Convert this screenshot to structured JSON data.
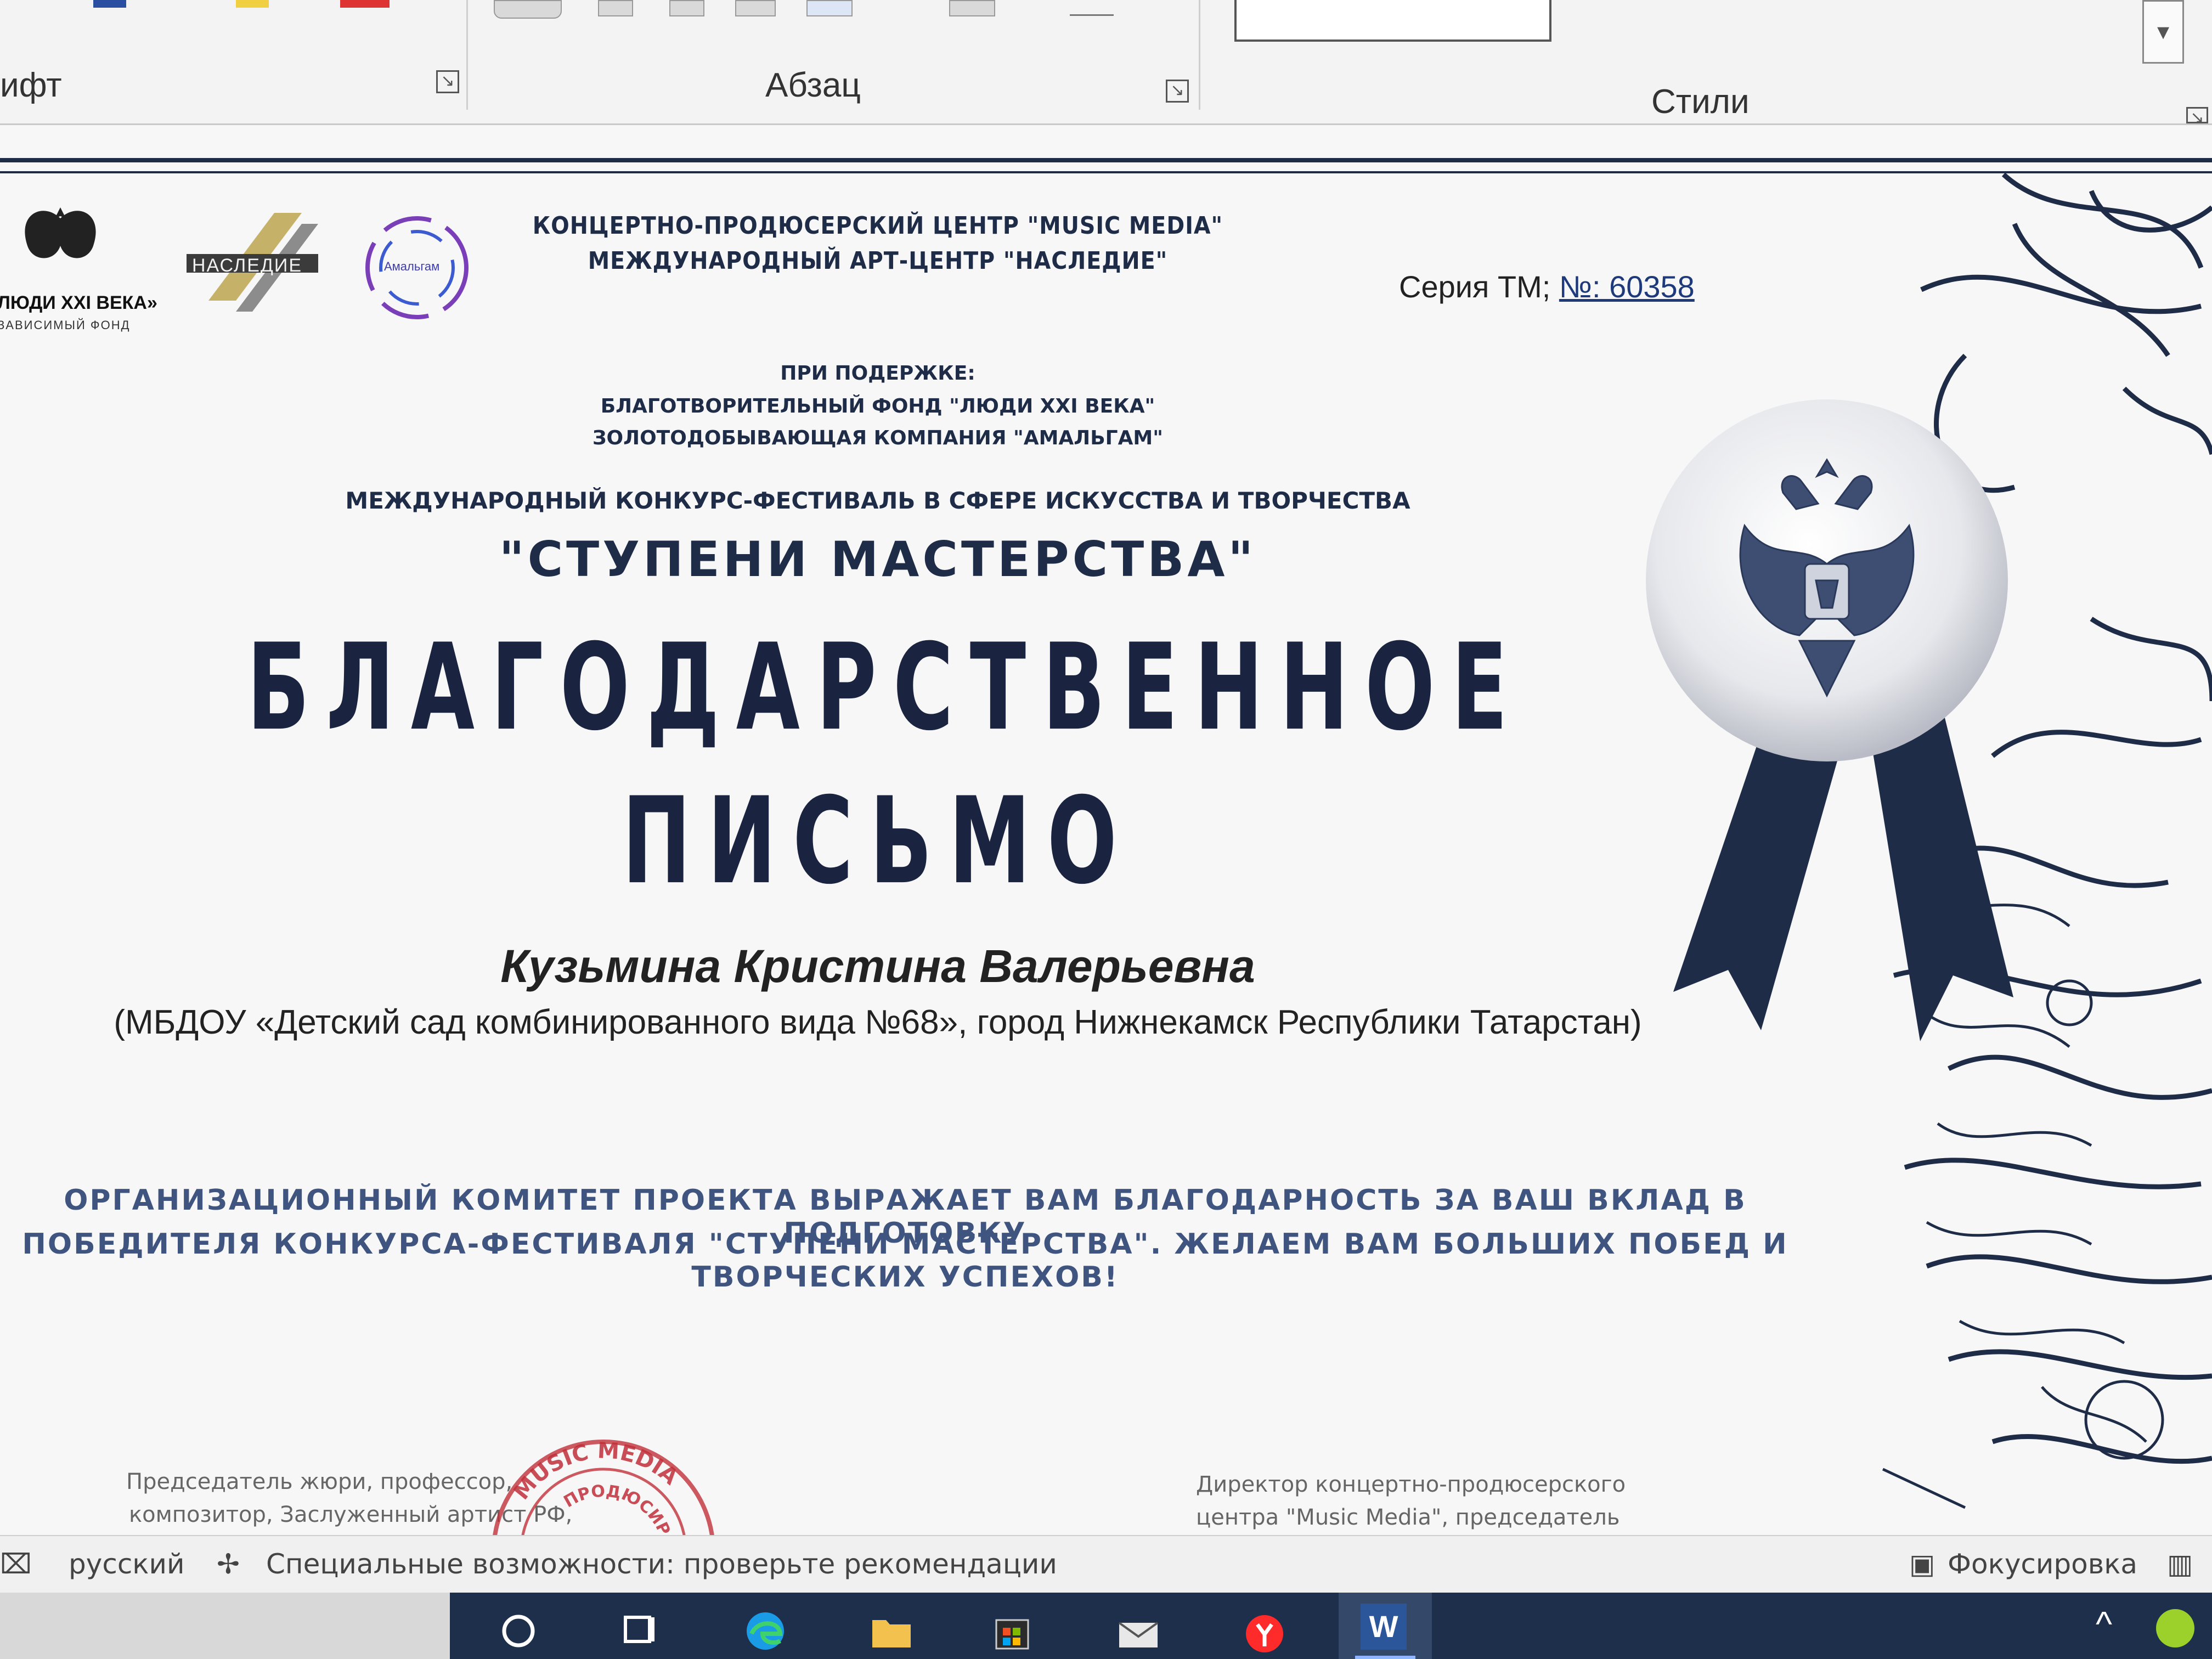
{
  "ribbon": {
    "font_group_label": "ифт",
    "paragraph_group_label": "Абзац",
    "styles_group_label": "Стили"
  },
  "document": {
    "logos": {
      "logo1_line1": "ЛЮДИ XXI ВЕКА»",
      "logo1_line2": "ЗАВИСИМЫЙ ФОНД",
      "logo2_text": "НАСЛЕДИЕ",
      "logo3_text": "Амальгам"
    },
    "organizer_line1": "КОНЦЕРТНО-ПРОДЮСЕРСКИЙ ЦЕНТР \"MUSIC MEDIA\"",
    "organizer_line2": "МЕЖДУНАРОДНЫЙ АРТ-ЦЕНТР \"НАСЛЕДИЕ\"",
    "series_label": "Серия ТМ; ",
    "series_number": "№: 60358",
    "support_heading": "ПРИ ПОДЕРЖКЕ:",
    "support_line1": "БЛАГОТВОРИТЕЛЬНЫЙ ФОНД \"ЛЮДИ XXI ВЕКА\"",
    "support_line2": "ЗОЛОТОДОБЫВАЮЩАЯ КОМПАНИЯ \"АМАЛЬГАМ\"",
    "contest_type": "МЕЖДУНАРОДНЫЙ КОНКУРС-ФЕСТИВАЛЬ В СФЕРЕ ИСКУССТВА И ТВОРЧЕСТВА",
    "contest_name": "\"СТУПЕНИ МАСТЕРСТВА\"",
    "title_line1": "БЛАГОДАРСТВЕННОЕ",
    "title_line2": "ПИСЬМО",
    "recipient_name": "Кузьмина Кристина Валерьевна",
    "recipient_affiliation": "(МБДОУ «Детский сад комбинированного вида №68», город Нижнекамск Республики Татарстан)",
    "thanks_line1": "ОРГАНИЗАЦИОННЫЙ КОМИТЕТ ПРОЕКТА ВЫРАЖАЕТ ВАМ БЛАГОДАРНОСТЬ ЗА ВАШ ВКЛАД В ПОДГОТОВКУ",
    "thanks_line2": "ПОБЕДИТЕЛЯ КОНКУРСА-ФЕСТИВАЛЯ \"СТУПЕНИ МАСТЕРСТВА\". ЖЕЛАЕМ ВАМ БОЛЬШИХ ПОБЕД И ТВОРЧЕСКИХ УСПЕХОВ!",
    "sig_left_line1": "Председатель жюри, профессор,",
    "sig_left_line2": "композитор, Заслуженный артист РФ,",
    "sig_right_line1": "Директор концертно-продюсерского",
    "sig_right_line2": "центра \"Music Media\", председатель",
    "stamp_text_top": "MUSIC MEDIA",
    "stamp_text_bottom": "ПРОДЮСИРО"
  },
  "statusbar": {
    "language": "русский",
    "accessibility": "Специальные возможности: проверьте рекомендации",
    "focus_mode": "Фокусировка"
  },
  "taskbar": {
    "word_label": "W"
  },
  "colors": {
    "navy": "#1f2c48",
    "accent_blue": "#3f5580",
    "taskbar": "#1d2f4b",
    "stamp_red": "#c0303a"
  },
  "icons": [
    "dialog-launcher-icon",
    "coat-of-arms-icon",
    "ribbon-medal-icon",
    "search-icon",
    "task-view-icon",
    "edge-icon",
    "file-explorer-icon",
    "store-icon",
    "mail-icon",
    "yandex-browser-icon",
    "word-icon",
    "spellcheck-icon",
    "accessibility-icon",
    "focus-icon",
    "read-mode-icon"
  ]
}
